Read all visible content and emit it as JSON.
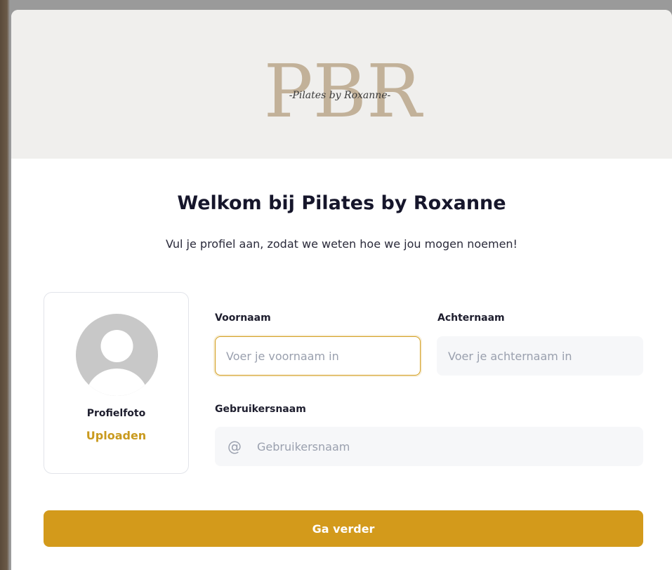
{
  "logo": {
    "monogram": "PBR",
    "script_text": "-Pilates by Roxanne-"
  },
  "heading": {
    "title": "Welkom bij Pilates by Roxanne",
    "subtitle": "Vul je profiel aan, zodat we weten hoe we jou mogen noemen!"
  },
  "profile_photo": {
    "label": "Profielfoto",
    "upload_label": "Uploaden",
    "icon": "avatar-placeholder-icon"
  },
  "form": {
    "first_name": {
      "label": "Voornaam",
      "placeholder": "Voer je voornaam in",
      "value": ""
    },
    "last_name": {
      "label": "Achternaam",
      "placeholder": "Voer je achternaam in",
      "value": ""
    },
    "username": {
      "label": "Gebruikersnaam",
      "placeholder": "Gebruikersnaam",
      "value": "",
      "prefix_icon": "at-sign-icon",
      "prefix_symbol": "@"
    }
  },
  "actions": {
    "continue_label": "Ga verder"
  },
  "colors": {
    "accent": "#d39a1b",
    "banner_bg": "#f0efed",
    "logo_tan": "#c2b199",
    "title_text": "#16162b",
    "input_bg": "#f6f7f9",
    "avatar_grey": "#c8c8c8"
  }
}
